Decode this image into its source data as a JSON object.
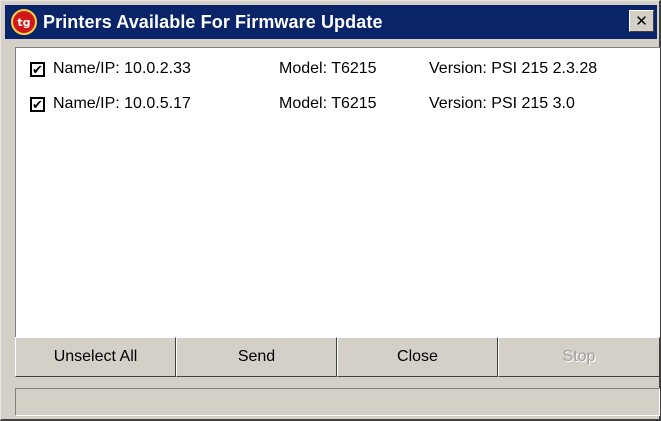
{
  "window": {
    "title": "Printers Available For Firmware Update",
    "app_icon_glyph": "tg",
    "close_glyph": "✕",
    "title_bar_color": "#0a246a"
  },
  "printers": [
    {
      "checked": true,
      "check_glyph": "✔",
      "name_label": "Name/IP:",
      "name": "10.0.2.33",
      "model_label": "Model:",
      "model": "T6215",
      "version_label": "Version:",
      "version": "PSI 215 2.3.28"
    },
    {
      "checked": true,
      "check_glyph": "✔",
      "name_label": "Name/IP:",
      "name": "10.0.5.17",
      "model_label": "Model:",
      "model": "T6215",
      "version_label": "Version:",
      "version": "PSI 215 3.0"
    }
  ],
  "buttons": {
    "unselect_all": "Unselect All",
    "send": "Send",
    "close": "Close",
    "stop": "Stop"
  },
  "status": {
    "text": ""
  }
}
